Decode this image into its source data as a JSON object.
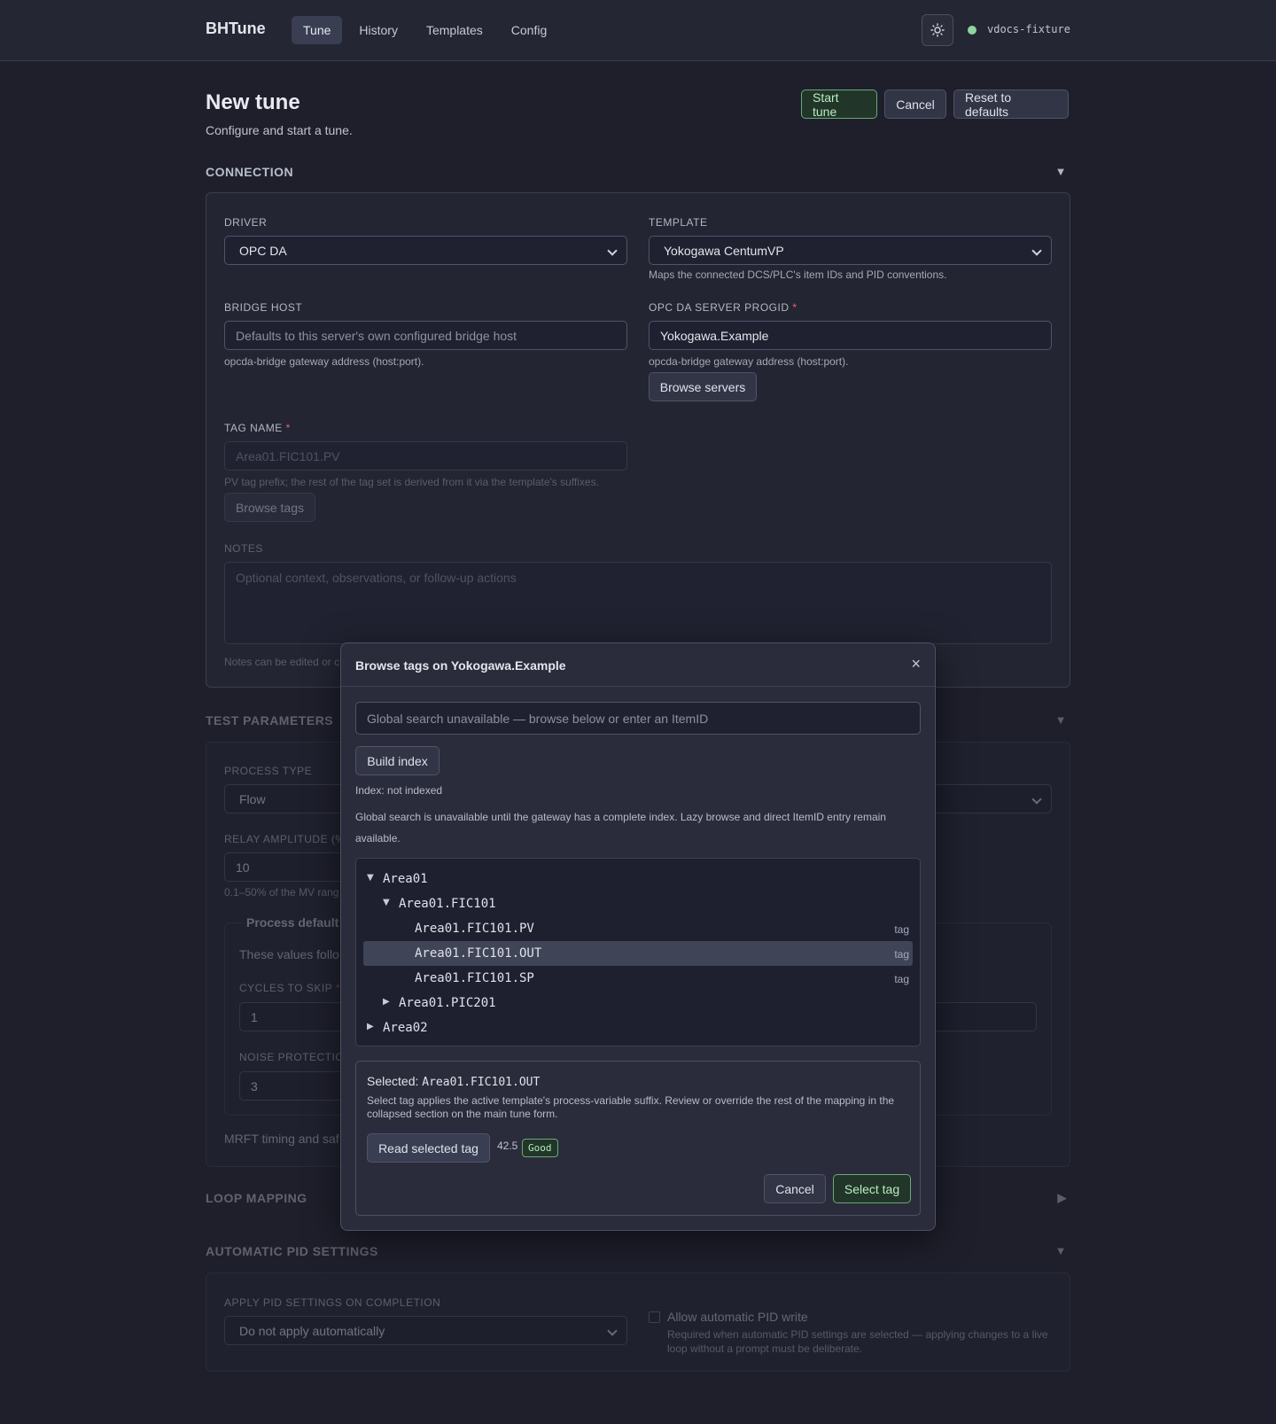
{
  "app": {
    "brand": "BHTune",
    "nav": [
      "Tune",
      "History",
      "Templates",
      "Config"
    ],
    "status_text": "vdocs-fixture",
    "status_color": "#8fd49a"
  },
  "page": {
    "title": "New tune",
    "subtitle": "Configure and start a tune.",
    "actions": {
      "start": "Start tune",
      "cancel": "Cancel",
      "reset": "Reset to defaults"
    }
  },
  "connection": {
    "heading": "CONNECTION",
    "driver_label": "DRIVER",
    "driver_value": "OPC DA",
    "template_label": "TEMPLATE",
    "template_value": "Yokogawa CentumVP",
    "template_hint": "Maps the connected DCS/PLC's item IDs and PID conventions.",
    "bridge_label": "BRIDGE HOST",
    "bridge_placeholder": "Defaults to this server's own configured bridge host",
    "bridge_hint": "opcda-bridge gateway address (host:port).",
    "progid_label": "OPC DA SERVER PROGID",
    "progid_value": "Yokogawa.Example",
    "progid_hint": "opcda-bridge gateway address (host:port).",
    "browse_servers": "Browse servers",
    "tag_label": "TAG NAME",
    "tag_placeholder": "Area01.FIC101.PV",
    "tag_hint": "PV tag prefix; the rest of the tag set is derived from it via the template's suffixes.",
    "browse_tags": "Browse tags",
    "notes_label": "NOTES",
    "notes_placeholder": "Optional context, observations, or follow-up actions",
    "notes_hint": "Notes can be edited or c"
  },
  "test_params": {
    "heading": "TEST PARAMETERS",
    "process_type_label": "PROCESS TYPE",
    "process_type_value": "Flow",
    "relay_label": "RELAY AMPLITUDE (%",
    "relay_value": "10",
    "relay_hint": "0.1–50% of the MV rang",
    "defaults_legend": "Process default",
    "defaults_text": "These values follo",
    "cycles_label": "CYCLES TO SKIP",
    "cycles_value": "1",
    "noise_label": "NOISE PROTECTIO",
    "noise_value": "3",
    "footer": "MRFT timing and saf"
  },
  "loop_mapping": {
    "heading": "LOOP MAPPING"
  },
  "pid": {
    "heading": "AUTOMATIC PID SETTINGS",
    "apply_label": "APPLY PID SETTINGS ON COMPLETION",
    "apply_value": "Do not apply automatically",
    "allow_label": "Allow automatic PID write",
    "allow_hint": "Required when automatic PID settings are selected — applying changes to a live loop without a prompt must be deliberate."
  },
  "modal": {
    "title": "Browse tags on Yokogawa.Example",
    "close": "×",
    "search_placeholder": "Global search unavailable — browse below or enter an ItemID",
    "build_index": "Build index",
    "index_status": "Index: not indexed",
    "index_note": "Global search is unavailable until the gateway has a complete index. Lazy browse and direct ItemID entry remain available.",
    "tree": [
      {
        "label": "Area01",
        "twisty": "▼",
        "kind": ""
      },
      {
        "label": "Area01.FIC101",
        "twisty": "▼",
        "kind": ""
      },
      {
        "label": "Area01.FIC101.PV",
        "twisty": "",
        "kind": "tag"
      },
      {
        "label": "Area01.FIC101.OUT",
        "twisty": "",
        "kind": "tag"
      },
      {
        "label": "Area01.FIC101.SP",
        "twisty": "",
        "kind": "tag"
      },
      {
        "label": "Area01.PIC201",
        "twisty": "▶",
        "kind": ""
      },
      {
        "label": "Area02",
        "twisty": "▶",
        "kind": ""
      }
    ],
    "selected_prefix": "Selected:",
    "selected_value": "Area01.FIC101.OUT",
    "selected_note": "Select tag applies the active template's process-variable suffix. Review or override the rest of the mapping in the collapsed section on the main tune form.",
    "read_button": "Read selected tag",
    "read_value": "42.5",
    "read_quality": "Good",
    "cancel": "Cancel",
    "select": "Select tag"
  }
}
